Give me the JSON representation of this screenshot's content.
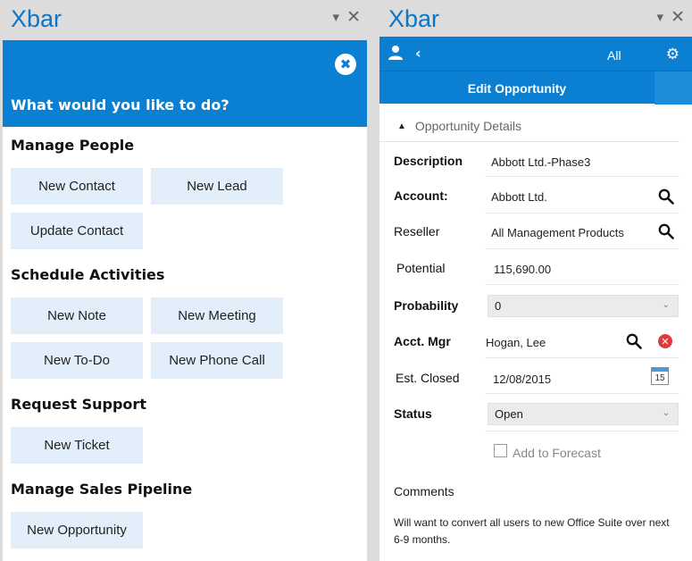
{
  "left_panel": {
    "title": "Xbar",
    "minimize_glyph": "▾",
    "close_glyph": "✕",
    "header_close_glyph": "✖",
    "prompt": "What would you like to do?",
    "sections": [
      {
        "title": "Manage People",
        "actions": [
          "New Contact",
          "New Lead",
          "Update Contact"
        ]
      },
      {
        "title": "Schedule Activities",
        "actions": [
          "New Note",
          "New Meeting",
          "New To-Do",
          "New Phone Call"
        ]
      },
      {
        "title": "Request Support",
        "actions": [
          "New Ticket"
        ]
      },
      {
        "title": "Manage Sales Pipeline",
        "actions": [
          "New Opportunity"
        ]
      }
    ]
  },
  "right_panel": {
    "title": "Xbar",
    "minimize_glyph": "▾",
    "close_glyph": "✕",
    "toolbar": {
      "back_glyph": "‹",
      "filter_label": "All",
      "gear_glyph": "⚙"
    },
    "tab_label": "Edit Opportunity",
    "details_header": "Opportunity Details",
    "details_toggle_glyph": "▲",
    "fields": {
      "description": {
        "label": "Description",
        "value": "Abbott Ltd.-Phase3"
      },
      "account": {
        "label": "Account:",
        "value": "Abbott Ltd."
      },
      "reseller": {
        "label": "Reseller",
        "value": "All Management Products"
      },
      "potential": {
        "label": "Potential",
        "value": "115,690.00"
      },
      "probability": {
        "label": "Probability",
        "value": "0"
      },
      "acct_mgr": {
        "label": "Acct. Mgr",
        "value": "Hogan, Lee"
      },
      "est_closed": {
        "label": "Est. Closed",
        "value": "12/08/2015"
      },
      "status": {
        "label": "Status",
        "value": "Open"
      }
    },
    "chevron_glyph": "⌄",
    "clear_glyph": "✕",
    "calendar_day": "15",
    "add_to_forecast": {
      "label": "Add to Forecast",
      "checked": false
    },
    "comments": {
      "label": "Comments",
      "text": "Will want to convert all users to new Office Suite over next 6-9 months."
    }
  },
  "colors": {
    "accent": "#0b7fd1",
    "title_blue": "#0b76c6",
    "button_bg": "#e2effa",
    "clear_red": "#e23a3a"
  },
  "icons": [
    "person-icon",
    "back-icon",
    "gear-icon",
    "search-icon",
    "clear-icon",
    "calendar-icon",
    "close-icon",
    "minimize-icon",
    "collapse-icon"
  ]
}
